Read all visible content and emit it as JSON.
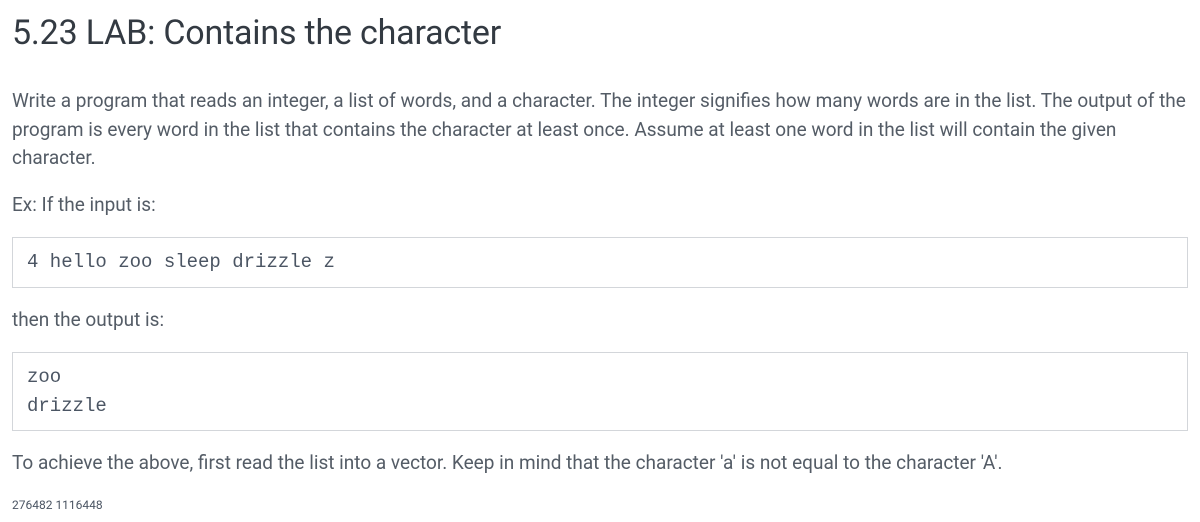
{
  "title": "5.23 LAB: Contains the character",
  "paragraphs": {
    "intro": "Write a program that reads an integer, a list of words, and a character. The integer signifies how many words are in the list. The output of the program is every word in the list that contains the character at least once. Assume at least one word in the list will contain the given character.",
    "example_label": "Ex: If the input is:",
    "output_label": "then the output is:",
    "closing": "To achieve the above, first read the list into a vector. Keep in mind that the character 'a' is not equal to the character 'A'."
  },
  "code": {
    "input": "4 hello zoo sleep drizzle z",
    "output": "zoo\ndrizzle"
  },
  "footer_id": "276482 1116448"
}
